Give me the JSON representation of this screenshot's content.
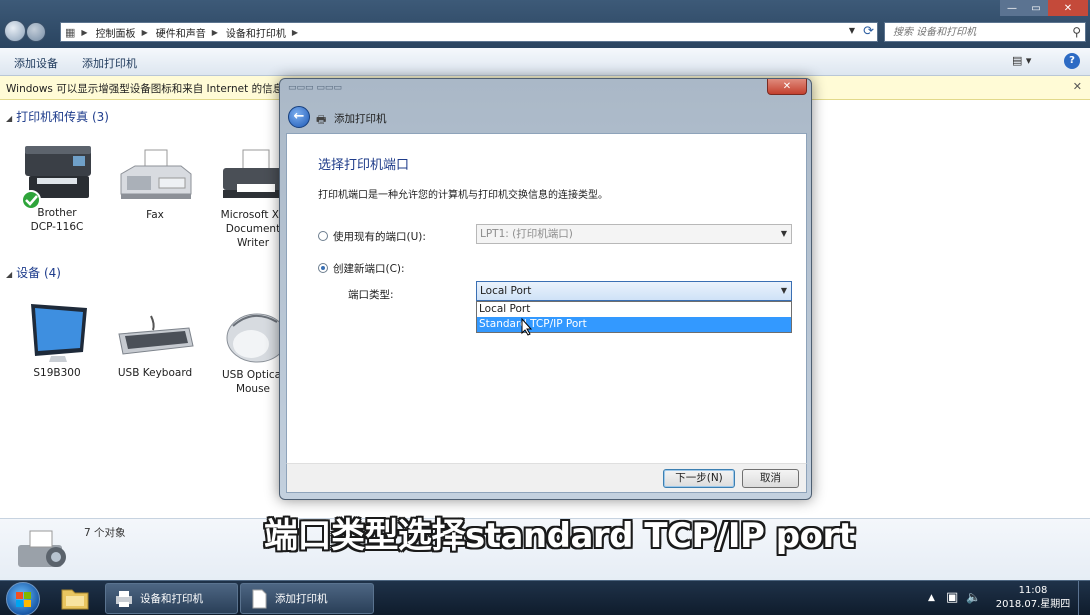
{
  "address_bar": {
    "segments": [
      "控制面板",
      "硬件和声音",
      "设备和打印机"
    ]
  },
  "search": {
    "placeholder": "搜索 设备和打印机"
  },
  "toolbar": {
    "add_device": "添加设备",
    "add_printer": "添加打印机"
  },
  "infobar": {
    "text": "Windows 可以显示增强型设备图标和来自 Internet 的信息。"
  },
  "groups": {
    "printers": {
      "title": "打印机和传真 (3)",
      "items": [
        {
          "label_line1": "Brother",
          "label_line2": "DCP-116C"
        },
        {
          "label_line1": "Fax",
          "label_line2": ""
        },
        {
          "label_line1": "Microsoft XP",
          "label_line2": "Document",
          "label_line3": "Writer"
        }
      ]
    },
    "devices": {
      "title": "设备 (4)",
      "items": [
        {
          "label_line1": "S19B300",
          "label_line2": ""
        },
        {
          "label_line1": "USB Keyboard",
          "label_line2": ""
        },
        {
          "label_line1": "USB Optical",
          "label_line2": "Mouse"
        }
      ]
    }
  },
  "status": {
    "count": "7 个对象"
  },
  "dialog": {
    "header": "添加打印机",
    "heading": "选择打印机端口",
    "description": "打印机端口是一种允许您的计算机与打印机交换信息的连接类型。",
    "radio_existing": {
      "label": "使用现有的端口(U):",
      "selected": false,
      "value": "LPT1: (打印机端口)"
    },
    "radio_new": {
      "label": "创建新端口(C):",
      "selected": true
    },
    "port_type": {
      "label": "端口类型:",
      "value": "Local Port",
      "options": [
        "Local Port",
        "Standard TCP/IP Port"
      ],
      "highlighted": "Standard TCP/IP Port"
    },
    "next_button": "下一步(N)",
    "cancel_button": "取消"
  },
  "caption": "端口类型选择standard TCP/IP port",
  "taskbar": {
    "items": [
      "设备和打印机",
      "添加打印机"
    ],
    "clock_time": "11:08",
    "clock_date": "2018.07.星期四"
  },
  "colors": {
    "accent": "#3399ff",
    "heading_blue": "#1f3c8a",
    "infobar_bg": "#fffbd6"
  }
}
